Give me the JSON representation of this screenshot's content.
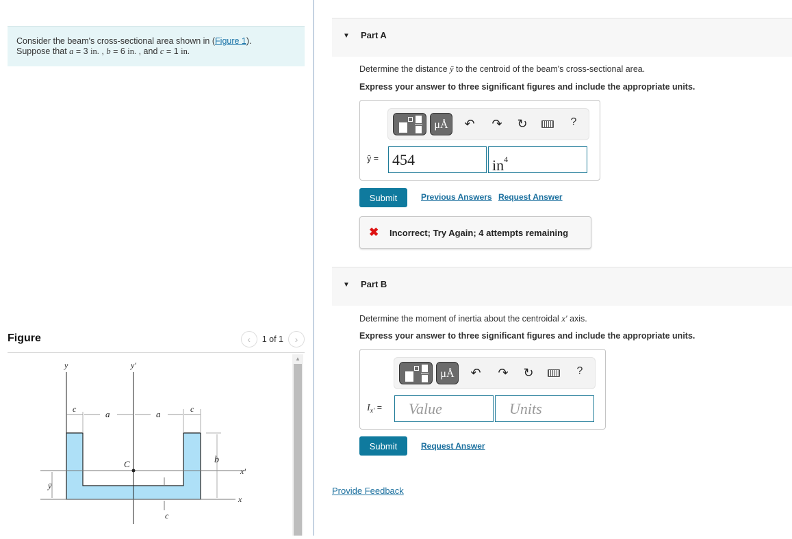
{
  "problem": {
    "line1_prefix": "Consider the beam's cross-sectional area shown in (",
    "figure_link": "Figure 1",
    "line1_suffix": ").",
    "line2": {
      "prefix": "Suppose that ",
      "a_var": "a",
      "a_eq": " = 3 ",
      "a_unit": "in.",
      "sep1": " , ",
      "b_var": "b",
      "b_eq": " = 6 ",
      "b_unit": "in.",
      "sep2": " , and ",
      "c_var": "c",
      "c_eq": " = 1 ",
      "c_unit": "in."
    }
  },
  "figure": {
    "title": "Figure",
    "pager_text": "1 of 1",
    "prev_icon": "‹",
    "next_icon": "›",
    "labels": {
      "y": "y",
      "y_prime": "y′",
      "x": "x",
      "x_prime": "x′",
      "c": "c",
      "a": "a",
      "b": "b",
      "C": "C",
      "ybar": "ȳ"
    },
    "colors": {
      "fill": "#aee0f7",
      "stroke": "#222222"
    }
  },
  "part_a": {
    "title": "Part A",
    "question_prefix": "Determine the distance ",
    "question_var": "ȳ",
    "question_suffix": " to the centroid of the beam's cross-sectional area.",
    "instruction": "Express your answer to three significant figures and include the appropriate units.",
    "eq_label": "ȳ =",
    "value": "454",
    "units_base": "in",
    "units_exp": "4",
    "submit_label": "Submit",
    "previous_answers_label": "Previous Answers",
    "request_answer_label": "Request Answer",
    "feedback_icon": "✖",
    "feedback_message": "Incorrect; Try Again; 4 attempts remaining"
  },
  "part_b": {
    "title": "Part B",
    "question_prefix": "Determine the moment of inertia about the centroidal ",
    "question_var": "x′",
    "question_suffix": " axis.",
    "instruction": "Express your answer to three significant figures and include the appropriate units.",
    "eq_label_var": "I",
    "eq_label_sub": "x′",
    "eq_label_eq": " =",
    "value_placeholder": "Value",
    "units_placeholder": "Units",
    "submit_label": "Submit",
    "request_answer_label": "Request Answer"
  },
  "toolbar": {
    "units_label": "μÅ",
    "undo_icon": "↶",
    "redo_icon": "↷",
    "reset_icon": "↻",
    "help_icon": "?"
  },
  "footer": {
    "provide_feedback_label": "Provide Feedback"
  },
  "colors": {
    "accent": "#0f7a9e",
    "link": "#1a6f9e",
    "error": "#dd1111",
    "problem_bg": "#e6f5f7"
  }
}
